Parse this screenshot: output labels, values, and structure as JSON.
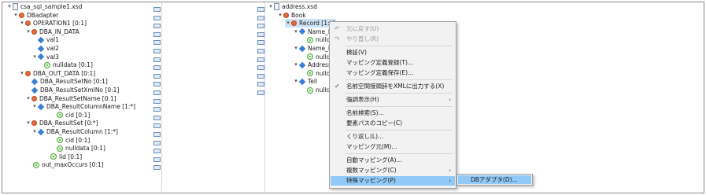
{
  "left_tree": {
    "file": "csa_sql_sample1.xsd",
    "nodes": [
      {
        "label": "DBadapter",
        "icon": "root"
      },
      {
        "label": "OPERATION1 [0:1]",
        "icon": "root"
      },
      {
        "label": "DBA_IN_DATA",
        "icon": "root"
      },
      {
        "label": "val1",
        "icon": "element"
      },
      {
        "label": "val2",
        "icon": "element"
      },
      {
        "label": "val3",
        "icon": "element"
      },
      {
        "label": "nulldata [0:1]",
        "icon": "attribute"
      },
      {
        "label": "DBA_OUT_DATA [0:1]",
        "icon": "root"
      },
      {
        "label": "DBA_ResultSetNo [0:1]",
        "icon": "element"
      },
      {
        "label": "DBA_ResultSetXmlNo [0:1]",
        "icon": "element"
      },
      {
        "label": "DBA_ResultSetName [0:1]",
        "icon": "root"
      },
      {
        "label": "DBA_ResultColumnName [1:*]",
        "icon": "element"
      },
      {
        "label": "cid [0:1]",
        "icon": "attribute"
      },
      {
        "label": "DBA_ResultSet [0:*]",
        "icon": "root"
      },
      {
        "label": "DBA_ResultColumn [1:*]",
        "icon": "element"
      },
      {
        "label": "cid [0:1]",
        "icon": "attribute"
      },
      {
        "label": "nulldata [0:1]",
        "icon": "attribute"
      },
      {
        "label": "lid [0:1]",
        "icon": "attribute"
      },
      {
        "label": "out_maxOccurs [0:1]",
        "icon": "attribute"
      }
    ]
  },
  "right_tree": {
    "file": "address.xsd",
    "nodes": [
      {
        "label": "Book",
        "icon": "root"
      },
      {
        "label": "Record [1:*]",
        "icon": "root"
      },
      {
        "label": "Name_Ka",
        "icon": "element"
      },
      {
        "label": "nulldata",
        "icon": "attribute"
      },
      {
        "label": "Name_Ka",
        "icon": "element"
      },
      {
        "label": "nulldata",
        "icon": "attribute"
      },
      {
        "label": "Address",
        "icon": "element"
      },
      {
        "label": "nulldata",
        "icon": "attribute"
      },
      {
        "label": "Tell",
        "icon": "element"
      },
      {
        "label": "nulldata",
        "icon": "attribute"
      }
    ]
  },
  "context_menu": {
    "undo": "元に戻す(U)",
    "redo": "やり直し(R)",
    "validate": "検証(V)",
    "register_def": "マッピング定義登録(T)...",
    "save_def": "マッピング定義保存(E)...",
    "output_ns": "名前空間接頭辞をXMLに出力する(X)",
    "highlight": "強調表示(H)",
    "search_name": "名前検索(S)...",
    "copy_path": "要素パスのコピー(C)",
    "repeat": "くり返し(L)...",
    "mapping_source": "マッピング元(M)...",
    "auto_mapping": "自動マッピング(A)...",
    "multi_mapping": "複数マッピング(C)",
    "special_mapping": "特殊マッピング(P)"
  },
  "submenu": {
    "db_adapter": "DBアダプタ(D)..."
  },
  "colors": {
    "highlight": "#91c9f7",
    "selected_row": "#cde4f7",
    "element_icon": "#3a7fd6",
    "root_icon": "#e56b3a",
    "attribute_icon": "#4aa53a"
  }
}
